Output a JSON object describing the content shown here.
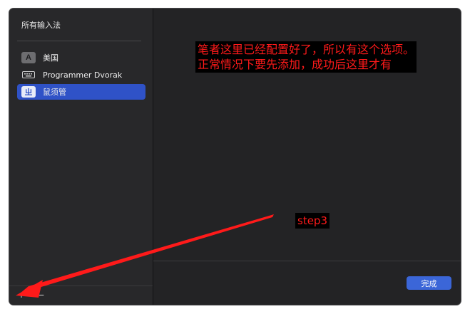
{
  "sidebar": {
    "title": "所有输入法",
    "items": [
      {
        "label": "美国",
        "icon": "letter-a-icon",
        "icon_text": "A",
        "selected": false
      },
      {
        "label": "Programmer Dvorak",
        "icon": "keyboard-icon",
        "selected": false
      },
      {
        "label": "鼠须管",
        "icon": "squirrel-icon",
        "icon_text": "ㄓ",
        "selected": true
      }
    ],
    "add_symbol": "+",
    "remove_symbol": "−"
  },
  "main": {
    "done_label": "完成"
  },
  "annotation": {
    "line1": "笔者这里已经配置好了，所以有这个选项。",
    "line2": "正常情况下要先添加，成功后这里才有",
    "step": "step3",
    "color": "#ff1a1a"
  },
  "colors": {
    "accent": "#2f52c7",
    "done_button": "#3b66d8"
  }
}
